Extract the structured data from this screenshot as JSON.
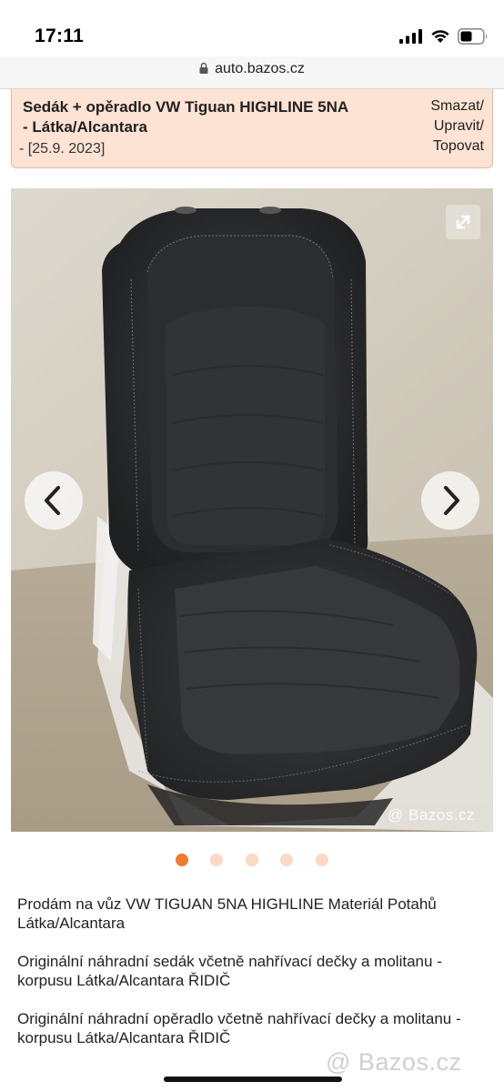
{
  "status_bar": {
    "time": "17:11"
  },
  "url_bar": {
    "url": "auto.bazos.cz"
  },
  "listing": {
    "title": "Sedák + opěradlo VW Tiguan HIGHLINE 5NA - Látka/Alcantara",
    "date": "- [25.9. 2023]",
    "actions": [
      "Smazat/",
      "Upravit/",
      "Topovat"
    ]
  },
  "gallery": {
    "watermark": "@ Bazos.cz",
    "image_count": 5,
    "active_index": 0
  },
  "description": {
    "paragraphs": [
      "Prodám na vůz VW TIGUAN 5NA HIGHLINE Materiál Potahů Látka/Alcantara",
      "Originální náhradní sedák včetně nahřívací dečky a molitanu - korpusu Látka/Alcantara ŘIDIČ",
      "Originální náhradní opěradlo včetně nahřívací dečky a molitanu - korpusu Látka/Alcantara ŘIDIČ"
    ]
  },
  "footer": {
    "watermark": "@ Bazos.cz"
  },
  "colors": {
    "header_bg": "#fde3d3",
    "accent": "#f07a2d",
    "dot_inactive": "#fbd9c4"
  }
}
